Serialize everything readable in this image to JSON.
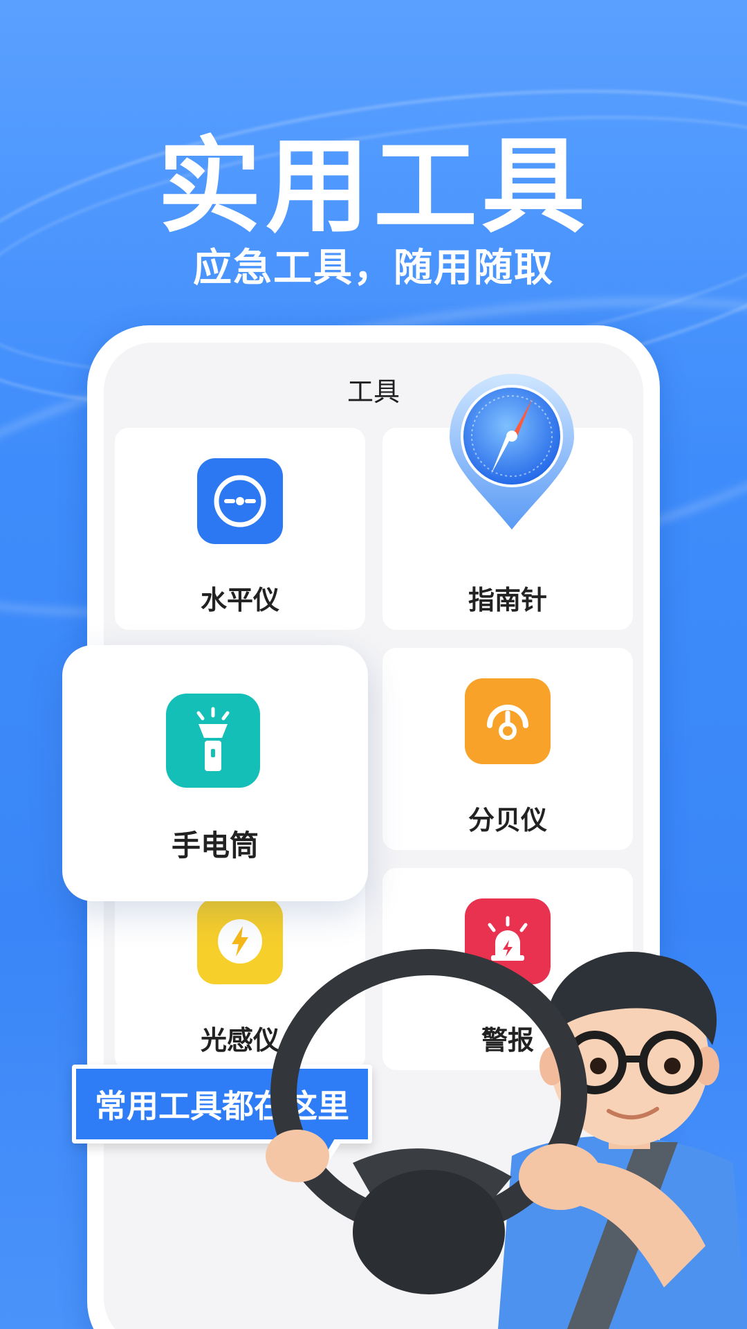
{
  "hero": {
    "title": "实用工具",
    "subtitle": "应急工具，随用随取"
  },
  "screen": {
    "title": "工具"
  },
  "tools": [
    {
      "label": "水平仪",
      "icon": "level-icon",
      "color": "#2b78f2"
    },
    {
      "label": "指南针",
      "icon": "compass-icon",
      "color": "#3a8ef7"
    },
    {
      "label": "手电筒",
      "icon": "flashlight-icon",
      "color": "#13bfb7"
    },
    {
      "label": "分贝仪",
      "icon": "decibel-icon",
      "color": "#f9a22a"
    },
    {
      "label": "光感仪",
      "icon": "light-sensor-icon",
      "color": "#f7cf2b"
    },
    {
      "label": "警报",
      "icon": "alarm-icon",
      "color": "#e8324f"
    }
  ],
  "bubble": {
    "text": "常用工具都在这里"
  }
}
